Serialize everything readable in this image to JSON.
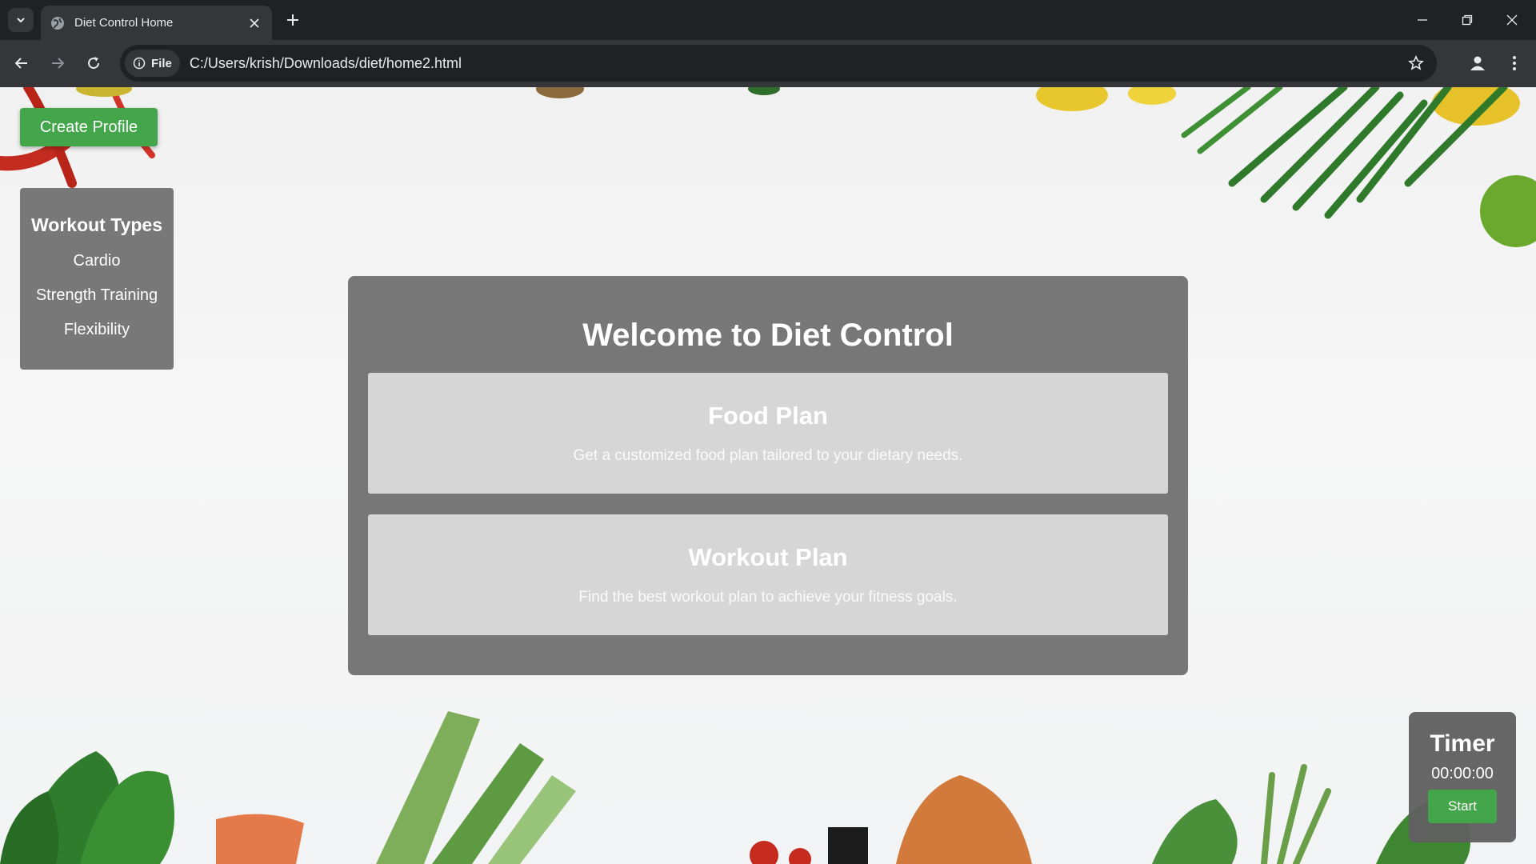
{
  "browser": {
    "tab_title": "Diet Control Home",
    "url_chip": "File",
    "url": "C:/Users/krish/Downloads/diet/home2.html"
  },
  "page": {
    "create_profile_label": "Create Profile",
    "sidebar": {
      "title": "Workout Types",
      "items": [
        "Cardio",
        "Strength Training",
        "Flexibility"
      ]
    },
    "welcome_title": "Welcome to Diet Control",
    "plans": [
      {
        "title": "Food Plan",
        "description": "Get a customized food plan tailored to your dietary needs."
      },
      {
        "title": "Workout Plan",
        "description": "Find the best workout plan to achieve your fitness goals."
      }
    ],
    "timer": {
      "title": "Timer",
      "time": "00:00:00",
      "start_label": "Start"
    }
  },
  "colors": {
    "accent_green": "#43a64a",
    "card_gray": "#707070",
    "plan_gray": "#d6d6d6"
  },
  "icons": [
    "tab-search-icon",
    "globe-icon",
    "close-icon",
    "plus-icon",
    "minimize-icon",
    "restore-icon",
    "window-close-icon",
    "back-icon",
    "forward-icon",
    "reload-icon",
    "info-icon",
    "star-icon",
    "profile-icon",
    "menu-icon"
  ]
}
